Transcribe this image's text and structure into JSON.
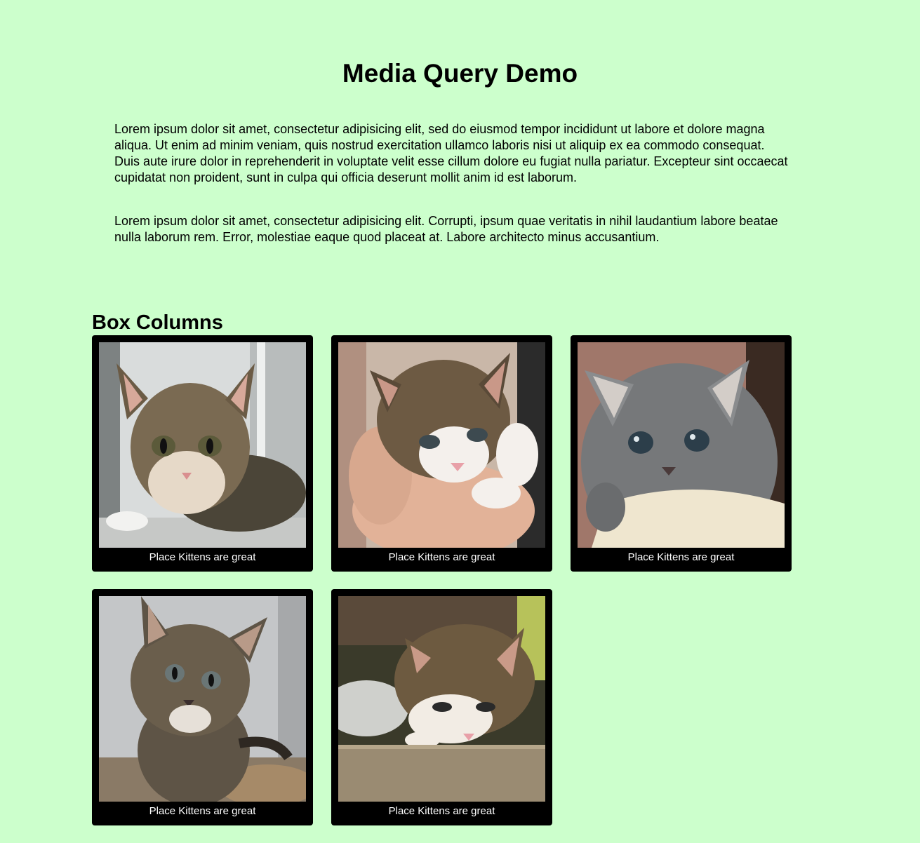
{
  "page": {
    "title": "Media Query Demo",
    "paragraphs": [
      "Lorem ipsum dolor sit amet, consectetur adipisicing elit, sed do eiusmod tempor incididunt ut labore et dolore magna aliqua. Ut enim ad minim veniam, quis nostrud exercitation ullamco laboris nisi ut aliquip ex ea commodo consequat. Duis aute irure dolor in reprehenderit in voluptate velit esse cillum dolore eu fugiat nulla pariatur. Excepteur sint occaecat cupidatat non proident, sunt in culpa qui officia deserunt mollit anim id est laborum.",
      "Lorem ipsum dolor sit amet, consectetur adipisicing elit. Corrupti, ipsum quae veritatis in nihil laudantium labore beatae nulla laborum rem. Error, molestiae eaque quod placeat at. Labore architecto minus accusantium."
    ],
    "section_heading": "Box Columns"
  },
  "cards": [
    {
      "caption": "Place Kittens are great",
      "image": "kitten-photo"
    },
    {
      "caption": "Place Kittens are great",
      "image": "kitten-photo"
    },
    {
      "caption": "Place Kittens are great",
      "image": "kitten-photo"
    },
    {
      "caption": "Place Kittens are great",
      "image": "kitten-photo"
    },
    {
      "caption": "Place Kittens are great",
      "image": "kitten-photo"
    }
  ],
  "colors": {
    "background": "#ccffcc",
    "card": "#000000",
    "caption_text": "#ffffff"
  }
}
